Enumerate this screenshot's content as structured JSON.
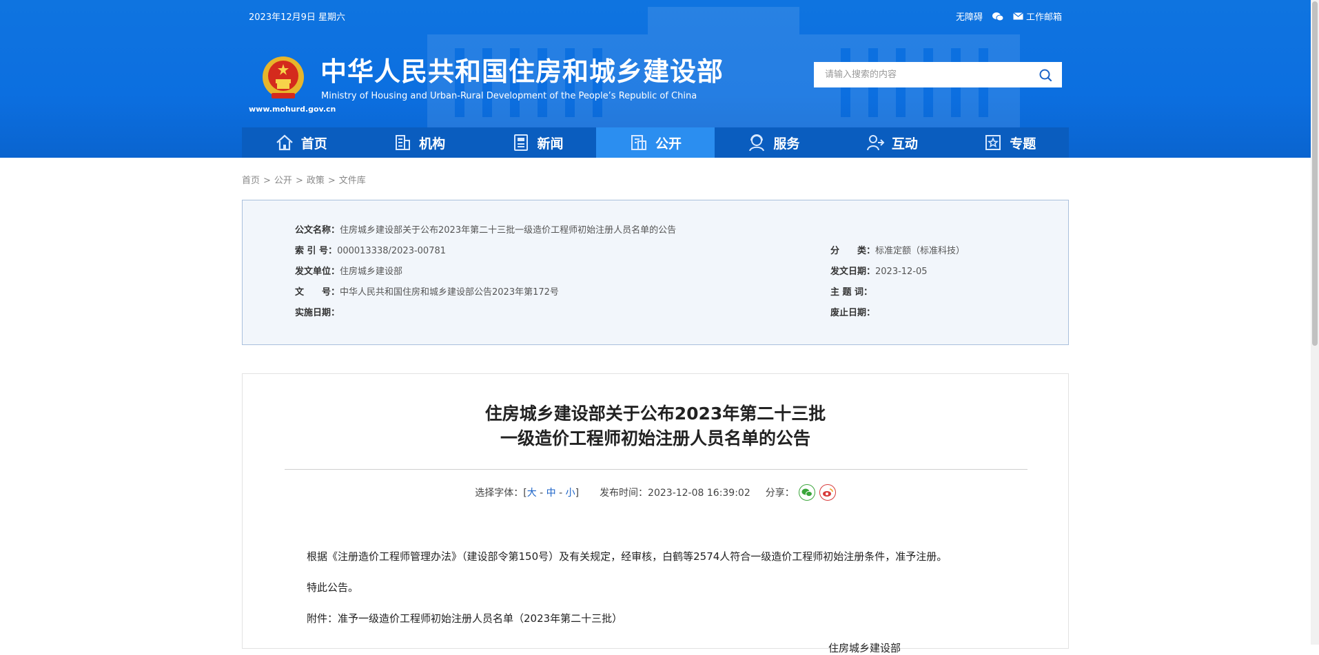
{
  "header": {
    "date": "2023年12月9日 星期六",
    "links": {
      "accessibility": "无障碍",
      "mail": "工作邮箱"
    },
    "title_cn": "中华人民共和国住房和城乡建设部",
    "title_en": "Ministry of Housing and Urban-Rural Development of the People’s Republic of China",
    "site_url": "www.mohurd.gov.cn",
    "search_placeholder": "请输入搜索的内容"
  },
  "nav": {
    "items": [
      {
        "label": "首页",
        "icon": "home-icon"
      },
      {
        "label": "机构",
        "icon": "building-icon"
      },
      {
        "label": "新闻",
        "icon": "news-icon"
      },
      {
        "label": "公开",
        "icon": "disclosure-icon",
        "active": true
      },
      {
        "label": "服务",
        "icon": "service-icon"
      },
      {
        "label": "互动",
        "icon": "interaction-icon"
      },
      {
        "label": "专题",
        "icon": "topic-icon"
      }
    ]
  },
  "breadcrumb": [
    "首页",
    "公开",
    "政策",
    "文件库"
  ],
  "info": {
    "name_label": "公文名称：",
    "name_value": "住房城乡建设部关于公布2023年第二十三批一级造价工程师初始注册人员名单的公告",
    "index_label": "索 引 号：",
    "index_value": "000013338/2023-00781",
    "category_label": "分　　类：",
    "category_value": "标准定额（标准科技）",
    "issuer_label": "发文单位：",
    "issuer_value": "住房城乡建设部",
    "date_label": "发文日期：",
    "date_value": "2023-12-05",
    "docno_label": "文　　号：",
    "docno_value": "中华人民共和国住房和城乡建设部公告2023年第172号",
    "keywords_label": "主 题 词：",
    "effective_label": "实施日期：",
    "expire_label": "废止日期："
  },
  "article": {
    "title_line1": "住房城乡建设部关于公布2023年第二十三批",
    "title_line2": "一级造价工程师初始注册人员名单的公告",
    "font_label": "选择字体：[",
    "font_large": "大",
    "font_medium": "中",
    "font_small": "小",
    "font_close": "]",
    "pub_label": "发布时间：2023-12-08 16:39:02",
    "share_label": "分享：",
    "para1": "根据《注册造价工程师管理办法》（建设部令第150号）及有关规定，经审核，白鹤等2574人符合一级造价工程师初始注册条件，准予注册。",
    "para2": "特此公告。",
    "para3": "附件：准予一级造价工程师初始注册人员名单（2023年第二十三批）",
    "signer": "住房城乡建设部"
  },
  "colors": {
    "header_blue": "#0c6fe0",
    "nav_blue": "#0a5dbf",
    "nav_active": "#2b8ef0",
    "link_blue": "#1a62c7"
  }
}
